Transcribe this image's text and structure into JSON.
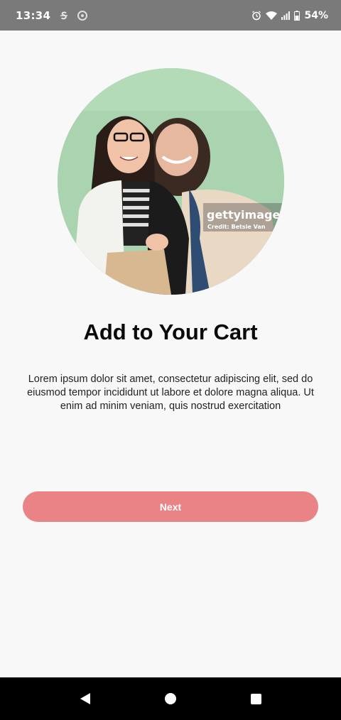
{
  "status_bar": {
    "time": "13:34",
    "battery_percent": "54%",
    "icons": [
      "sync-icon",
      "data-saver-icon",
      "alarm-icon",
      "wifi-icon",
      "signal-icon",
      "battery-icon"
    ]
  },
  "hero": {
    "watermark_brand": "gettyimages",
    "watermark_credit": "Credit: Betsie Van"
  },
  "content": {
    "title": "Add to Your Cart",
    "description": "Lorem ipsum dolor sit amet, consectetur adipiscing elit, sed do eiusmod tempor incididunt ut labore et dolore magna aliqua. Ut enim ad minim veniam, quis nostrud exercitation"
  },
  "actions": {
    "next_label": "Next"
  },
  "nav_bar": {
    "icons": [
      "back-icon",
      "home-icon",
      "recents-icon"
    ]
  },
  "colors": {
    "status_bar_bg": "#7a7a7a",
    "page_bg": "#f8f8f8",
    "button_bg": "#e98386",
    "button_text": "#ffffff",
    "nav_bg": "#000000"
  }
}
